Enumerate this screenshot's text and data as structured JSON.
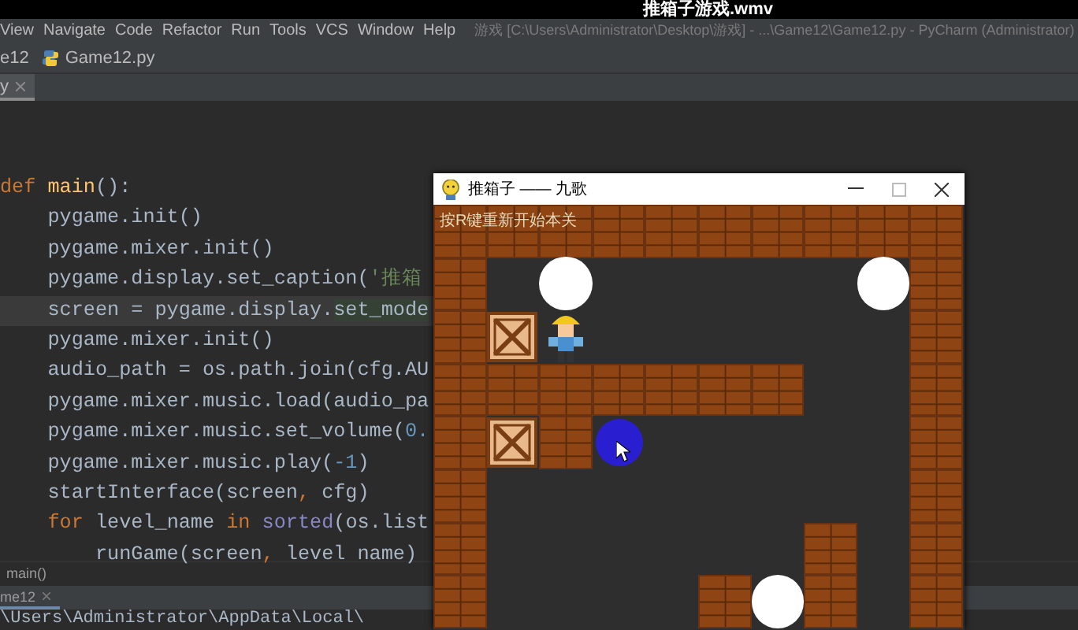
{
  "video_title": "推箱子游戏.wmv",
  "menu": [
    "View",
    "Navigate",
    "Code",
    "Refactor",
    "Run",
    "Tools",
    "VCS",
    "Window",
    "Help"
  ],
  "window_title": "游戏 [C:\\Users\\Administrator\\Desktop\\游戏] - ...\\Game12\\Game12.py - PyCharm (Administrator)",
  "nav_bar": {
    "project": "e12",
    "file": "Game12.py"
  },
  "editor_tabs": [
    {
      "label": "y",
      "selected": true
    }
  ],
  "code_lines": [
    {
      "current": false,
      "tokens": [
        {
          "text": "def ",
          "kind": "keyword"
        },
        {
          "text": "main",
          "kind": "func"
        },
        {
          "text": "():",
          "kind": "plain"
        }
      ]
    },
    {
      "current": false,
      "tokens": [
        {
          "text": "    pygame.init()",
          "kind": "plain"
        }
      ]
    },
    {
      "current": false,
      "tokens": [
        {
          "text": "    pygame.mixer.init()",
          "kind": "plain"
        }
      ]
    },
    {
      "current": false,
      "tokens": [
        {
          "text": "    pygame.display.set_caption(",
          "kind": "plain"
        },
        {
          "text": "'推箱",
          "kind": "string"
        }
      ]
    },
    {
      "current": true,
      "tokens": [
        {
          "text": "    screen = pygame.display.",
          "kind": "plain"
        },
        {
          "text": "set_mode",
          "kind": "highlight"
        }
      ]
    },
    {
      "current": false,
      "tokens": [
        {
          "text": "    pygame.mixer.init()",
          "kind": "plain"
        }
      ]
    },
    {
      "current": false,
      "tokens": [
        {
          "text": "    audio_path = os.path.join(cfg.AU",
          "kind": "plain"
        }
      ]
    },
    {
      "current": false,
      "tokens": [
        {
          "text": "    pygame.mixer.music.load(audio_pa",
          "kind": "plain"
        }
      ]
    },
    {
      "current": false,
      "tokens": [
        {
          "text": "    pygame.mixer.music.set_volume(",
          "kind": "plain"
        },
        {
          "text": "0.",
          "kind": "number"
        }
      ]
    },
    {
      "current": false,
      "tokens": [
        {
          "text": "    pygame.mixer.music.play(",
          "kind": "plain"
        },
        {
          "text": "-1",
          "kind": "number"
        },
        {
          "text": ")",
          "kind": "plain"
        }
      ]
    },
    {
      "current": false,
      "tokens": [
        {
          "text": "    startInterface(screen",
          "kind": "plain"
        },
        {
          "text": ", ",
          "kind": "punct"
        },
        {
          "text": "cfg)",
          "kind": "plain"
        }
      ]
    },
    {
      "current": false,
      "tokens": [
        {
          "text": "    for ",
          "kind": "keyword"
        },
        {
          "text": "level_name ",
          "kind": "plain"
        },
        {
          "text": "in ",
          "kind": "keyword"
        },
        {
          "text": "sorted",
          "kind": "builtin"
        },
        {
          "text": "(os.list",
          "kind": "plain"
        }
      ]
    },
    {
      "current": false,
      "tokens": [
        {
          "text": "        runGame(screen",
          "kind": "plain"
        },
        {
          "text": ", ",
          "kind": "punct"
        },
        {
          "text": "level name)",
          "kind": "plain"
        }
      ]
    }
  ],
  "breadcrumb": "main()",
  "run_tabs": [
    {
      "label": "me12",
      "selected": true
    }
  ],
  "console_line": "\\Users\\Administrator\\AppData\\Local\\",
  "game_window": {
    "title": "推箱子 —— 九歌",
    "hint": "按R键重新开始本关"
  }
}
